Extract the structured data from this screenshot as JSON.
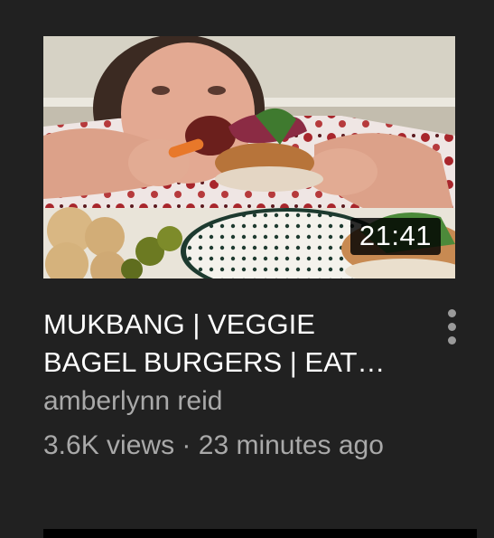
{
  "video": {
    "duration": "21:41",
    "title_line1": "MUKBANG | VEGGIE",
    "title_line2": "BAGEL BURGERS | EAT…",
    "channel": "amberlynn reid",
    "views": "3.6K views",
    "separator": "·",
    "age": "23 minutes ago"
  },
  "icons": {
    "menu": "more-vert-icon"
  },
  "colors": {
    "background": "#212121",
    "title": "#ffffff",
    "secondary_text": "#a9a9a9",
    "duration_badge": "#000000"
  }
}
